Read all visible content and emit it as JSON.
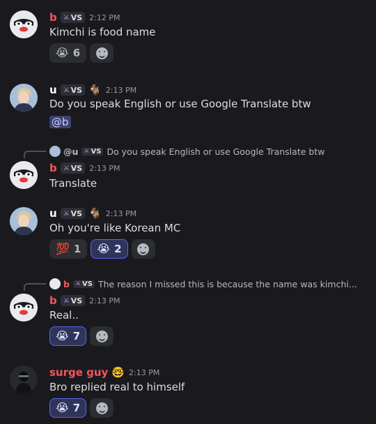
{
  "colors": {
    "background": "#1a1a1e",
    "name_red": "#f2565a",
    "name_white": "#ffffff",
    "mention_bg": "#3c4270",
    "reaction_active_border": "#5865f2"
  },
  "messages": [
    {
      "author": "b",
      "tag": "VS",
      "tag_icon": "sword-icon",
      "time": "2:12 PM",
      "text": "Kimchi is food name",
      "reactions": [
        {
          "emoji": "😭",
          "count": "6",
          "active": false
        }
      ]
    },
    {
      "author": "u",
      "tag": "VS",
      "tag_icon": "sword-icon",
      "badge": "🐐",
      "time": "2:13 PM",
      "text": "Do you speak English or use Google Translate btw",
      "mention": "@b"
    },
    {
      "author": "b",
      "tag": "VS",
      "tag_icon": "sword-icon",
      "time": "2:13 PM",
      "text": "Translate",
      "reply": {
        "author": "@u",
        "tag": "VS",
        "text": "Do you speak English or use Google Translate btw"
      }
    },
    {
      "author": "u",
      "tag": "VS",
      "tag_icon": "sword-icon",
      "badge": "🐐",
      "time": "2:13 PM",
      "text": "Oh you're like Korean MC",
      "reactions": [
        {
          "emoji": "💯",
          "count": "1",
          "active": false
        },
        {
          "emoji": "😭",
          "count": "2",
          "active": true
        }
      ]
    },
    {
      "author": "b",
      "tag": "VS",
      "tag_icon": "sword-icon",
      "time": "2:13 PM",
      "text": "Real..",
      "reply": {
        "author": "b",
        "tag": "VS",
        "text": "The reason I missed this is because the name was kimchi..."
      },
      "reactions": [
        {
          "emoji": "😭",
          "count": "7",
          "active": true
        }
      ]
    },
    {
      "author": "surge guy",
      "badge": "🤓",
      "time": "2:13 PM",
      "text": "Bro replied real to himself",
      "reactions": [
        {
          "emoji": "😭",
          "count": "7",
          "active": true
        }
      ]
    }
  ]
}
